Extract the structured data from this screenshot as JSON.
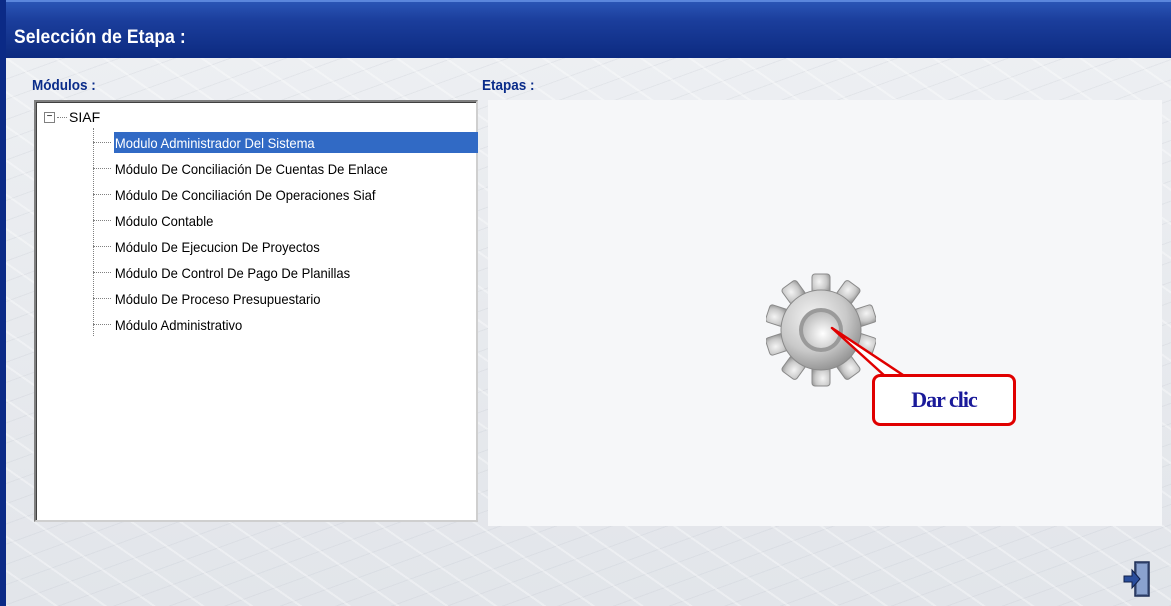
{
  "window": {
    "title": "Selección de Etapa :"
  },
  "modulos": {
    "label": "Módulos :",
    "root": {
      "expander": "−",
      "label": "SIAF"
    },
    "items": [
      {
        "label": "Modulo Administrador Del Sistema",
        "selected": true
      },
      {
        "label": "Módulo De Conciliación De Cuentas De Enlace",
        "selected": false
      },
      {
        "label": "Módulo De Conciliación De Operaciones Siaf",
        "selected": false
      },
      {
        "label": "Módulo Contable",
        "selected": false
      },
      {
        "label": "Módulo De Ejecucion De Proyectos",
        "selected": false
      },
      {
        "label": "Módulo De Control De Pago De Planillas",
        "selected": false
      },
      {
        "label": "Módulo De Proceso Presupuestario",
        "selected": false
      },
      {
        "label": "Módulo Administrativo",
        "selected": false
      }
    ]
  },
  "etapas": {
    "label": "Etapas :",
    "icon": "gear-icon",
    "callout": "Dar clic"
  },
  "footer": {
    "exit_icon": "exit-door-icon"
  },
  "colors": {
    "title_bar": "#0c2a80",
    "selection": "#316ac5",
    "label_text": "#0a2c8a",
    "callout_border": "#e00000",
    "callout_text": "#1a1a9a"
  }
}
